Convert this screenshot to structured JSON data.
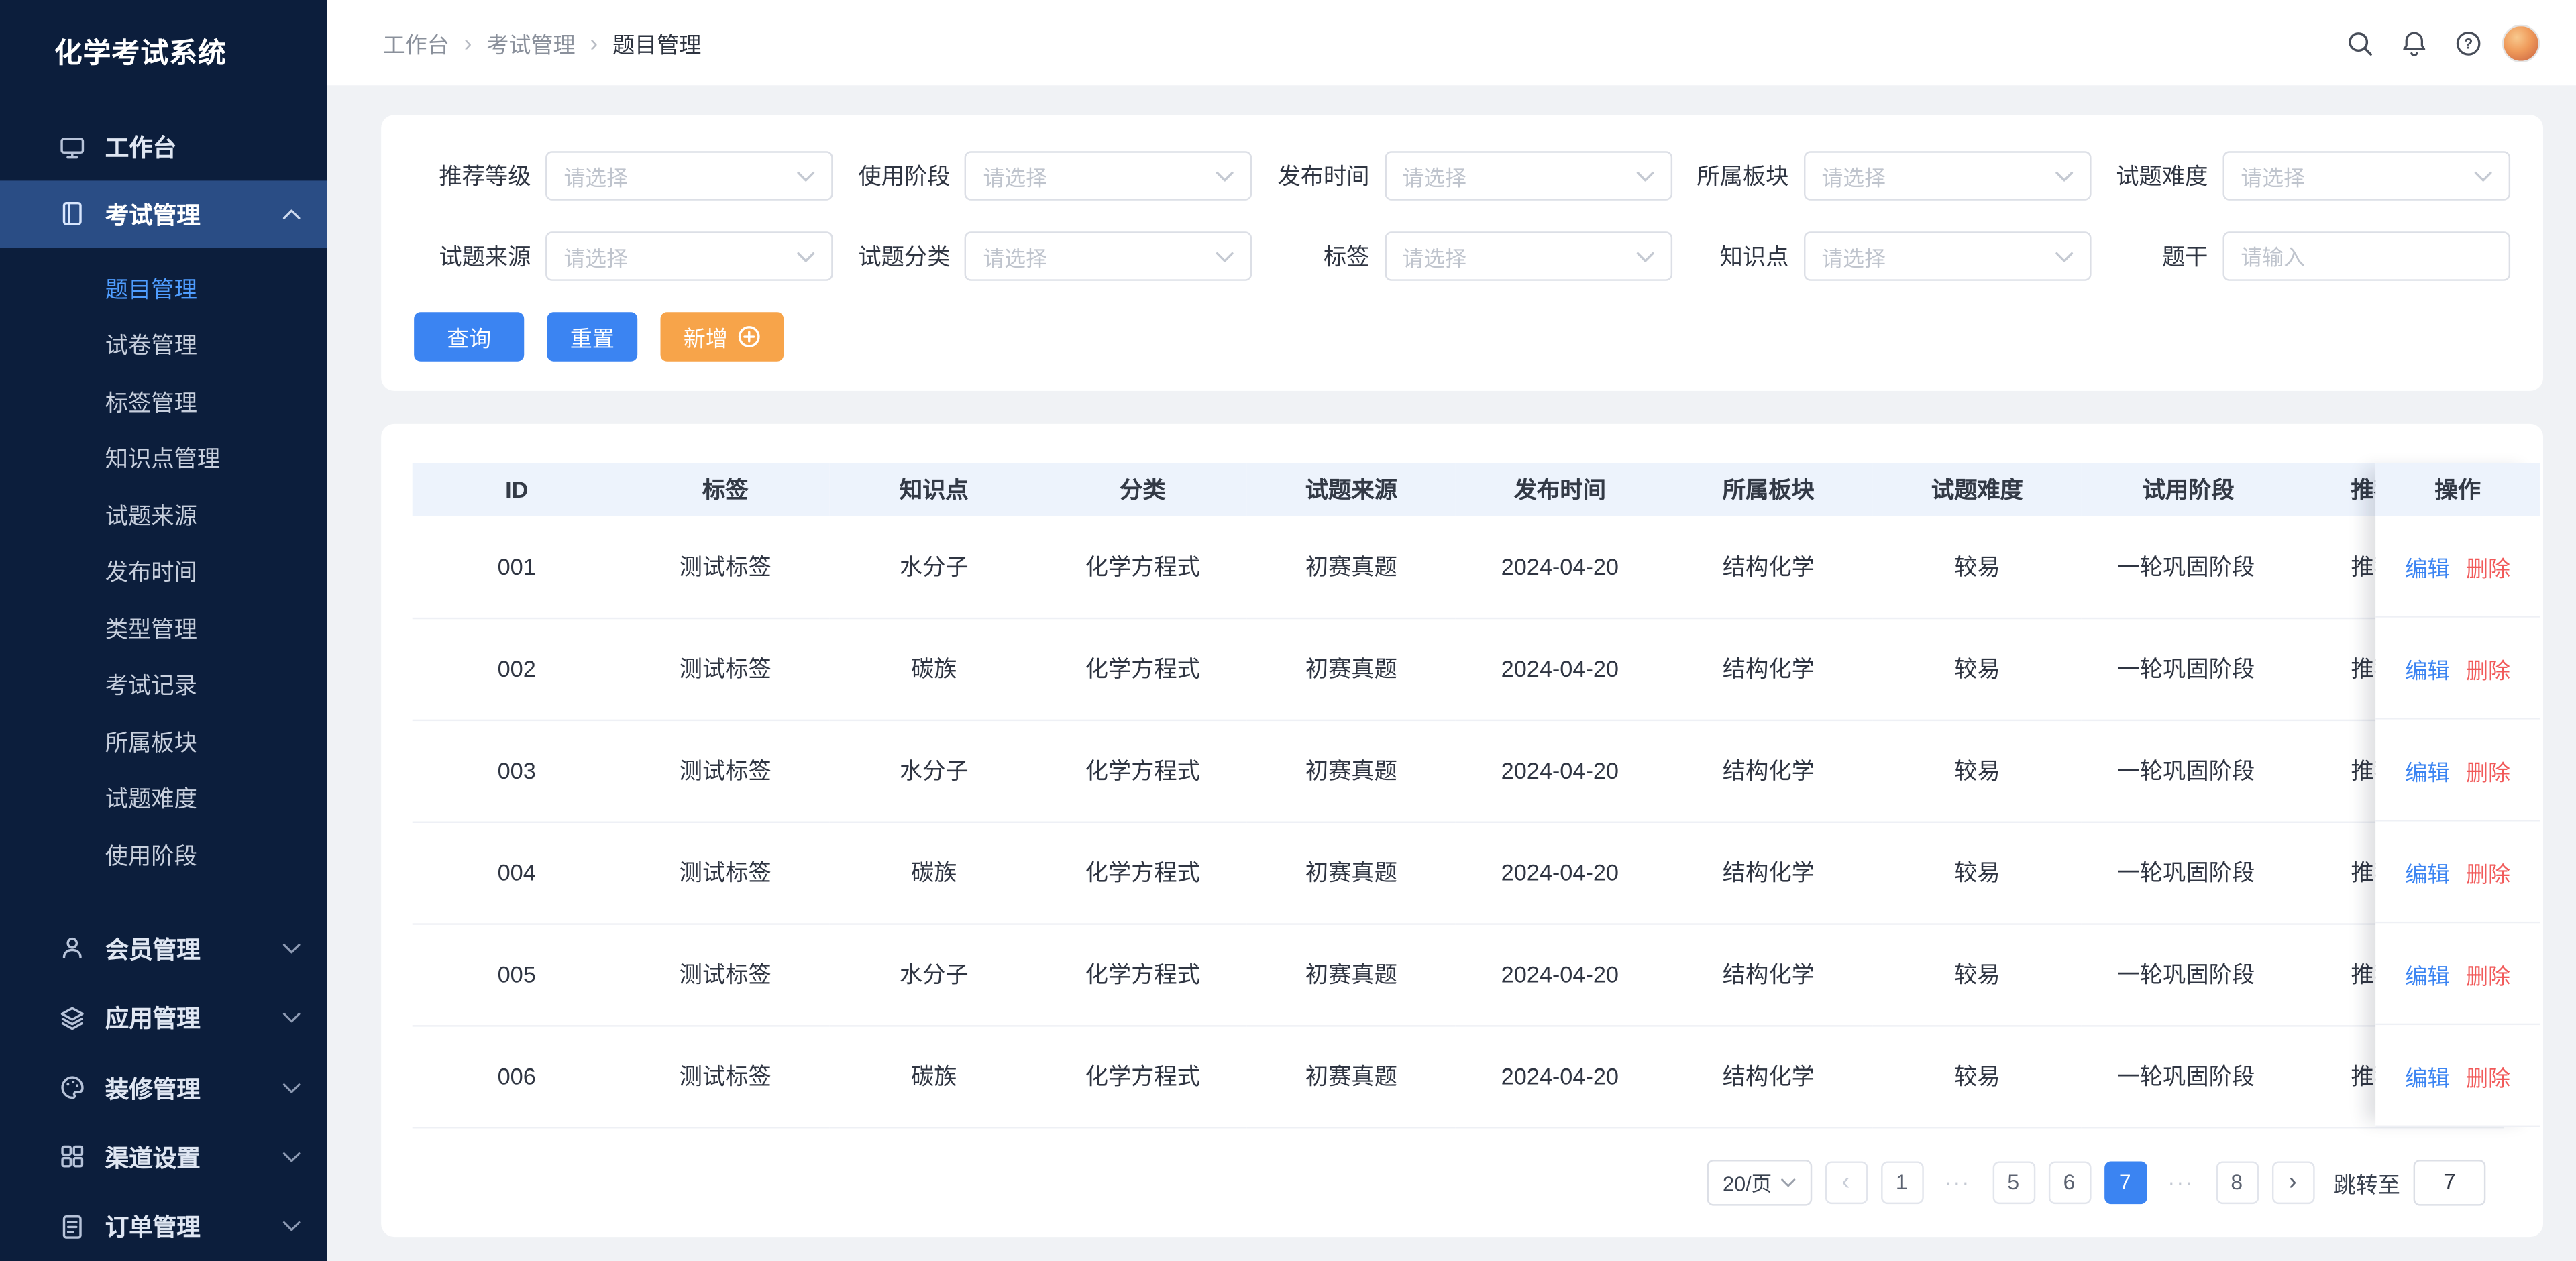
{
  "app_title": "化学考试系统",
  "breadcrumb": {
    "items": [
      "工作台",
      "考试管理",
      "题目管理"
    ],
    "separator": "›"
  },
  "sidebar": {
    "workbench": "工作台",
    "exam_group": "考试管理",
    "exam_children": [
      {
        "label": "题目管理",
        "cls": "active"
      },
      {
        "label": "试卷管理"
      },
      {
        "label": "标签管理"
      },
      {
        "label": "知识点管理"
      },
      {
        "label": "试题来源"
      },
      {
        "label": "发布时间"
      },
      {
        "label": "类型管理"
      },
      {
        "label": "考试记录"
      },
      {
        "label": "所属板块"
      },
      {
        "label": "试题难度"
      },
      {
        "label": "使用阶段"
      }
    ],
    "member": "会员管理",
    "application": "应用管理",
    "decoration": "装修管理",
    "channel": "渠道设置",
    "order": "订单管理"
  },
  "filters": {
    "fields": [
      {
        "label": "推荐等级",
        "placeholder": "请选择"
      },
      {
        "label": "使用阶段",
        "placeholder": "请选择"
      },
      {
        "label": "发布时间",
        "placeholder": "请选择"
      },
      {
        "label": "所属板块",
        "placeholder": "请选择"
      },
      {
        "label": "试题难度",
        "placeholder": "请选择"
      },
      {
        "label": "试题来源",
        "placeholder": "请选择"
      },
      {
        "label": "试题分类",
        "placeholder": "请选择"
      },
      {
        "label": "标签",
        "placeholder": "请选择"
      },
      {
        "label": "知识点",
        "placeholder": "请选择"
      },
      {
        "label": "题干",
        "placeholder": "请输入"
      }
    ],
    "buttons": {
      "search": "查询",
      "reset": "重置",
      "add": "新增"
    }
  },
  "table": {
    "columns": [
      "ID",
      "标签",
      "知识点",
      "分类",
      "试题来源",
      "发布时间",
      "所属板块",
      "试题难度",
      "试用阶段",
      "推荐等级"
    ],
    "action_column": "操作",
    "actions": {
      "edit": "编辑",
      "delete": "删除"
    },
    "rows": [
      {
        "id": "001",
        "tag": "测试标签",
        "point": "水分子",
        "category": "化学方程式",
        "source": "初赛真题",
        "date": "2024-04-20",
        "section": "结构化学",
        "difficulty": "较易",
        "stage": "一轮巩固阶段",
        "recommend": "推荐"
      },
      {
        "id": "002",
        "tag": "测试标签",
        "point": "碳族",
        "category": "化学方程式",
        "source": "初赛真题",
        "date": "2024-04-20",
        "section": "结构化学",
        "difficulty": "较易",
        "stage": "一轮巩固阶段",
        "recommend": "推荐"
      },
      {
        "id": "003",
        "tag": "测试标签",
        "point": "水分子",
        "category": "化学方程式",
        "source": "初赛真题",
        "date": "2024-04-20",
        "section": "结构化学",
        "difficulty": "较易",
        "stage": "一轮巩固阶段",
        "recommend": "推荐"
      },
      {
        "id": "004",
        "tag": "测试标签",
        "point": "碳族",
        "category": "化学方程式",
        "source": "初赛真题",
        "date": "2024-04-20",
        "section": "结构化学",
        "difficulty": "较易",
        "stage": "一轮巩固阶段",
        "recommend": "推荐"
      },
      {
        "id": "005",
        "tag": "测试标签",
        "point": "水分子",
        "category": "化学方程式",
        "source": "初赛真题",
        "date": "2024-04-20",
        "section": "结构化学",
        "difficulty": "较易",
        "stage": "一轮巩固阶段",
        "recommend": "推荐"
      },
      {
        "id": "006",
        "tag": "测试标签",
        "point": "碳族",
        "category": "化学方程式",
        "source": "初赛真题",
        "date": "2024-04-20",
        "section": "结构化学",
        "difficulty": "较易",
        "stage": "一轮巩固阶段",
        "recommend": "推荐"
      }
    ]
  },
  "pagination": {
    "page_size": "20/页",
    "pages": [
      {
        "label": "‹",
        "cls": "arrow disabled"
      },
      {
        "label": "1",
        "cls": "num"
      },
      {
        "label": "···",
        "cls": "dots"
      },
      {
        "label": "5",
        "cls": "num"
      },
      {
        "label": "6",
        "cls": "num"
      },
      {
        "label": "7",
        "cls": "num active"
      },
      {
        "label": "···",
        "cls": "dots"
      },
      {
        "label": "8",
        "cls": "num"
      },
      {
        "label": "›",
        "cls": "arrow"
      }
    ],
    "jump_label": "跳转至",
    "jump_value": "7"
  },
  "icons": {
    "header": [
      "search-icon",
      "bell-icon",
      "help-icon",
      "user-avatar"
    ],
    "sidebar": [
      "monitor-icon",
      "book-icon",
      "user-icon",
      "layers-icon",
      "palette-icon",
      "grid-icon",
      "document-icon"
    ],
    "select_chevron": "chevron-down-icon",
    "exam_expanded": "chevron-up-icon",
    "add_button": "plus-circle-icon"
  },
  "colors": {
    "primary": "#3b84f2",
    "accent_orange": "#f7a44a",
    "danger": "#f15a5a",
    "sidebar_bg": "#0c1e3c",
    "active_item_bg": "#2a4d85",
    "table_header_bg": "#edf3fc"
  }
}
